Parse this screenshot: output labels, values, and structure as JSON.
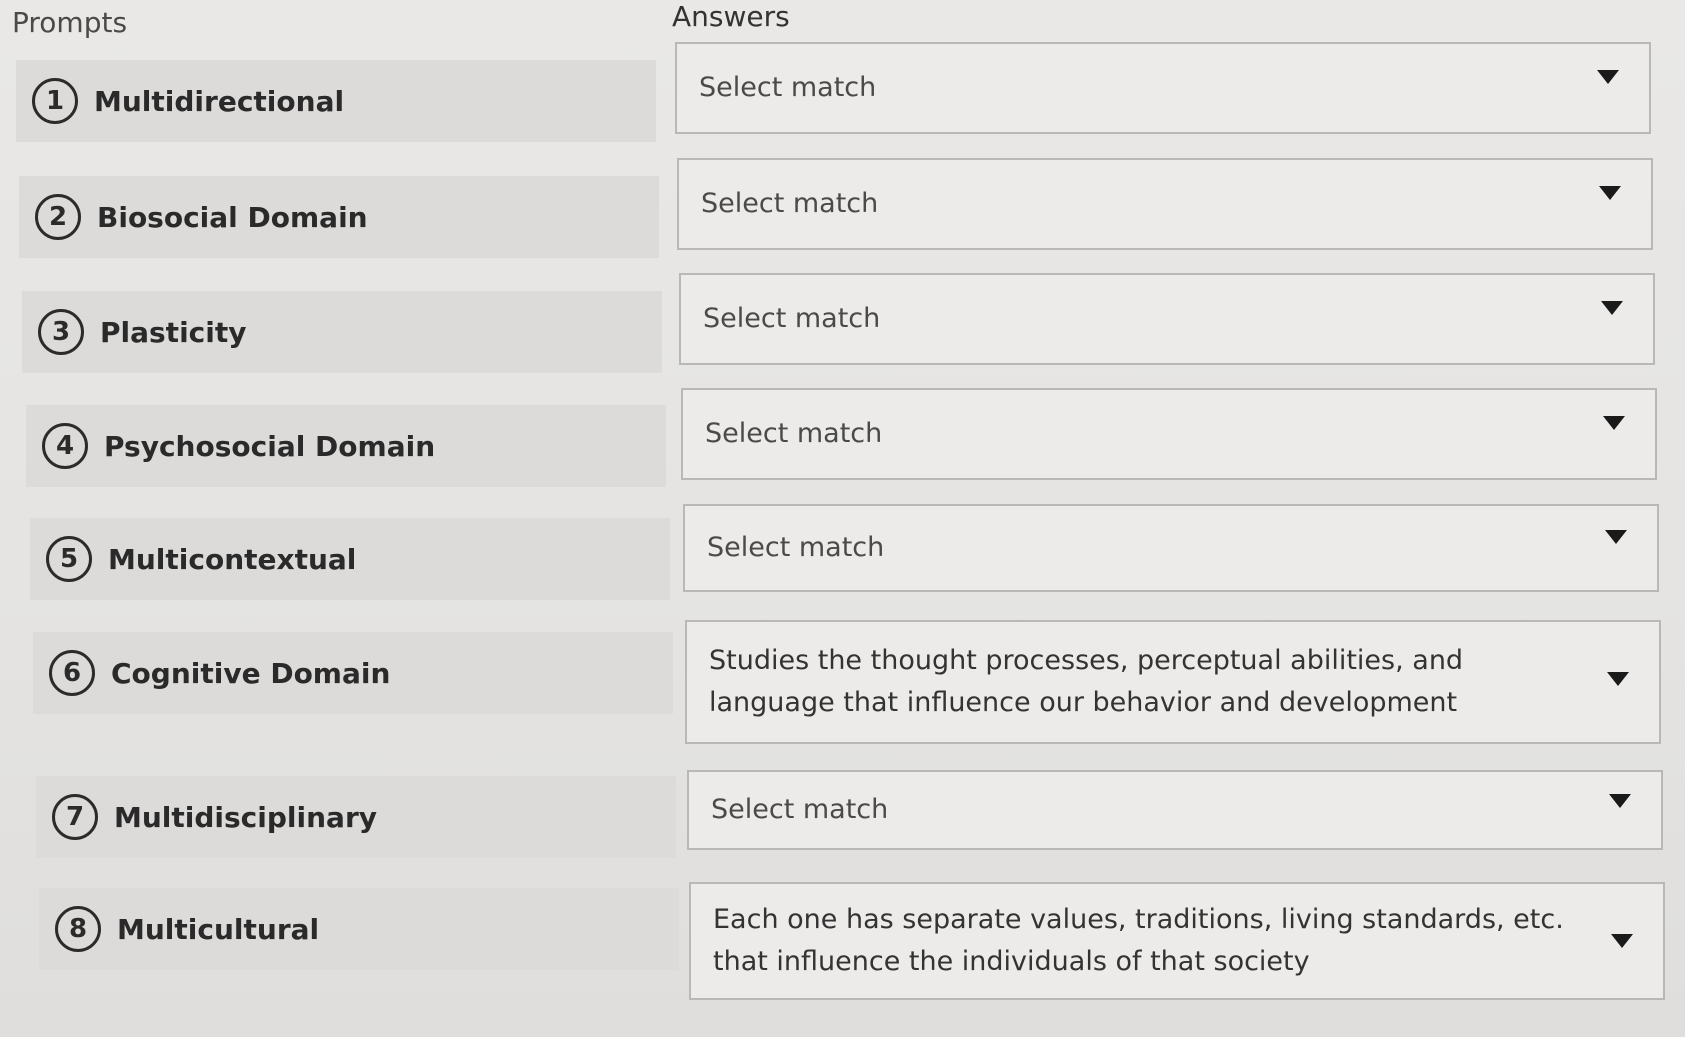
{
  "headers": {
    "prompts": "Prompts",
    "answers": "Answers"
  },
  "prompts": [
    {
      "number": "1",
      "label": "Multidirectional"
    },
    {
      "number": "2",
      "label": "Biosocial Domain"
    },
    {
      "number": "3",
      "label": "Plasticity"
    },
    {
      "number": "4",
      "label": "Psychosocial Domain"
    },
    {
      "number": "5",
      "label": "Multicontextual"
    },
    {
      "number": "6",
      "label": "Cognitive Domain"
    },
    {
      "number": "7",
      "label": "Multidisciplinary"
    },
    {
      "number": "8",
      "label": "Multicultural"
    }
  ],
  "answers": [
    {
      "value": "Select match",
      "is_placeholder": true
    },
    {
      "value": "Select match",
      "is_placeholder": true
    },
    {
      "value": "Select match",
      "is_placeholder": true
    },
    {
      "value": "Select match",
      "is_placeholder": true
    },
    {
      "value": "Select match",
      "is_placeholder": true
    },
    {
      "value": "Studies the thought processes, perceptual abilities, and language that influence our behavior and development",
      "is_placeholder": false
    },
    {
      "value": "Select match",
      "is_placeholder": true
    },
    {
      "value": "Each one has separate values, traditions, living standards, etc. that influence the individuals of that society",
      "is_placeholder": false
    }
  ],
  "icons": {
    "dropdown": "chevron-down-icon"
  }
}
